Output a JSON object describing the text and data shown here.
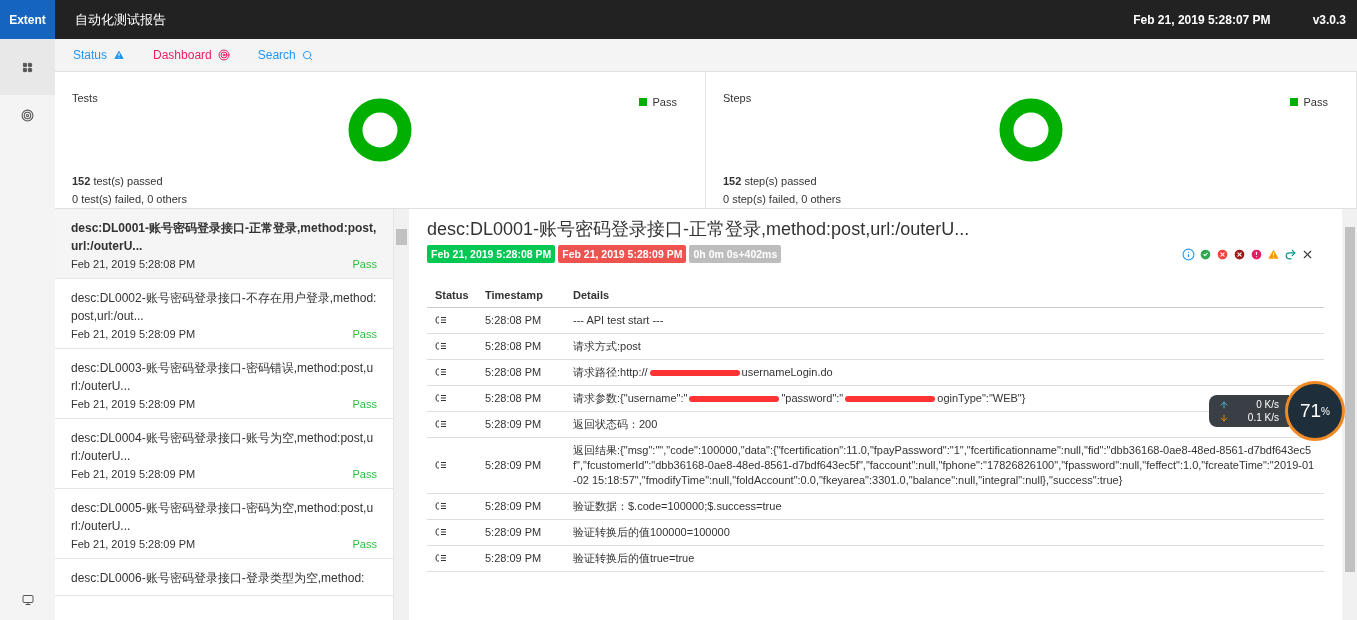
{
  "topbar": {
    "brand": "Extent",
    "title": "自动化测试报告",
    "timestamp": "Feb 21, 2019 5:28:07 PM",
    "version": "v3.0.3"
  },
  "sidenav": [
    {
      "kind": "grid",
      "selected": true
    },
    {
      "kind": "dashboard",
      "selected": false
    },
    {
      "kind": "monitor",
      "selected": false
    }
  ],
  "subnav": [
    {
      "label": "Status",
      "kind": "warning",
      "color": "#2196f3"
    },
    {
      "label": "Dashboard",
      "kind": "dashboard",
      "color": "#e91e63"
    },
    {
      "label": "Search",
      "kind": "search",
      "color": "#2196f3"
    }
  ],
  "summary": [
    {
      "title": "Tests",
      "legend": "Pass",
      "count": "152",
      "passed": "test(s) passed",
      "others": "0 test(s) failed, 0 others"
    },
    {
      "title": "Steps",
      "legend": "Pass",
      "count": "152",
      "passed": "step(s) passed",
      "others": "0 step(s) failed, 0 others"
    }
  ],
  "tests": [
    {
      "name": "desc:DL0001-账号密码登录接口-正常登录,method:post,url:/outerU...",
      "time": "Feb 21, 2019 5:28:08 PM",
      "status": "Pass",
      "selected": true
    },
    {
      "name": "desc:DL0002-账号密码登录接口-不存在用户登录,method:post,url:/out...",
      "time": "Feb 21, 2019 5:28:09 PM",
      "status": "Pass",
      "selected": false
    },
    {
      "name": "desc:DL0003-账号密码登录接口-密码错误,method:post,url:/outerU...",
      "time": "Feb 21, 2019 5:28:09 PM",
      "status": "Pass",
      "selected": false
    },
    {
      "name": "desc:DL0004-账号密码登录接口-账号为空,method:post,url:/outerU...",
      "time": "Feb 21, 2019 5:28:09 PM",
      "status": "Pass",
      "selected": false
    },
    {
      "name": "desc:DL0005-账号密码登录接口-密码为空,method:post,url:/outerU...",
      "time": "Feb 21, 2019 5:28:09 PM",
      "status": "Pass",
      "selected": false
    },
    {
      "name": "desc:DL0006-账号密码登录接口-登录类型为空,method:",
      "selected": false
    }
  ],
  "detail": {
    "title": "desc:DL0001-账号密码登录接口-正常登录,method:post,url:/outerU...",
    "badges": [
      {
        "text": "Feb 21, 2019 5:28:08 PM",
        "kind": "start"
      },
      {
        "text": "Feb 21, 2019 5:28:09 PM",
        "kind": "end"
      },
      {
        "text": "0h 0m 0s+402ms",
        "kind": "duration"
      }
    ],
    "filters": [
      {
        "kind": "info"
      },
      {
        "kind": "pass"
      },
      {
        "kind": "fail"
      },
      {
        "kind": "fatal"
      },
      {
        "kind": "error"
      },
      {
        "kind": "warning"
      },
      {
        "kind": "skip"
      },
      {
        "kind": "clear"
      }
    ],
    "columns": [
      "Status",
      "Timestamp",
      "Details"
    ],
    "steps": [
      {
        "time": "5:28:08 PM",
        "details": [
          {
            "kind": "text",
            "text": "--- API test start ---"
          }
        ]
      },
      {
        "time": "5:28:08 PM",
        "details": [
          {
            "kind": "text",
            "text": "请求方式:post"
          }
        ]
      },
      {
        "time": "5:28:08 PM",
        "details": [
          {
            "kind": "text",
            "text": "请求路径:http://"
          },
          {
            "kind": "redaction"
          },
          {
            "kind": "text",
            "text": "usernameLogin.do"
          }
        ]
      },
      {
        "time": "5:28:08 PM",
        "details": [
          {
            "kind": "text",
            "text": "请求参数:{\"username\":\""
          },
          {
            "kind": "redaction"
          },
          {
            "kind": "text",
            "text": "\"password\":\""
          },
          {
            "kind": "redaction"
          },
          {
            "kind": "text",
            "text": "oginType\":\"WEB\"}"
          }
        ]
      },
      {
        "time": "5:28:09 PM",
        "details": [
          {
            "kind": "text",
            "text": "返回状态码：200"
          }
        ]
      },
      {
        "time": "5:28:09 PM",
        "details": [
          {
            "kind": "text",
            "text": "返回结果:{\"msg\":\"\",\"code\":100000,\"data\":{\"fcertification\":11.0,\"fpayPassword\":\"1\",\"fcertificationname\":null,\"fid\":\"dbb36168-0ae8-48ed-8561-d7bdf643ec5f\",\"fcustomerId\":\"dbb36168-0ae8-48ed-8561-d7bdf643ec5f\",\"faccount\":null,\"fphone\":\"17826826100\",\"fpassword\":null,\"feffect\":1.0,\"fcreateTime\":\"2019-01-02 15:18:57\",\"fmodifyTime\":null,\"foldAccount\":0.0,\"fkeyarea\":3301.0,\"balance\":null,\"integral\":null},\"success\":true}"
          }
        ]
      },
      {
        "time": "5:28:09 PM",
        "details": [
          {
            "kind": "text",
            "text": "验证数据：$.code=100000;$.success=true"
          }
        ]
      },
      {
        "time": "5:28:09 PM",
        "details": [
          {
            "kind": "text",
            "text": "验证转换后的值100000=100000"
          }
        ]
      },
      {
        "time": "5:28:09 PM",
        "details": [
          {
            "kind": "text",
            "text": "验证转换后的值true=true"
          }
        ]
      }
    ]
  },
  "netspeed": {
    "up": "0",
    "up_unit": "K/s",
    "down": "0.1",
    "down_unit": "K/s",
    "percent": "71",
    "percent_sign": "%"
  }
}
